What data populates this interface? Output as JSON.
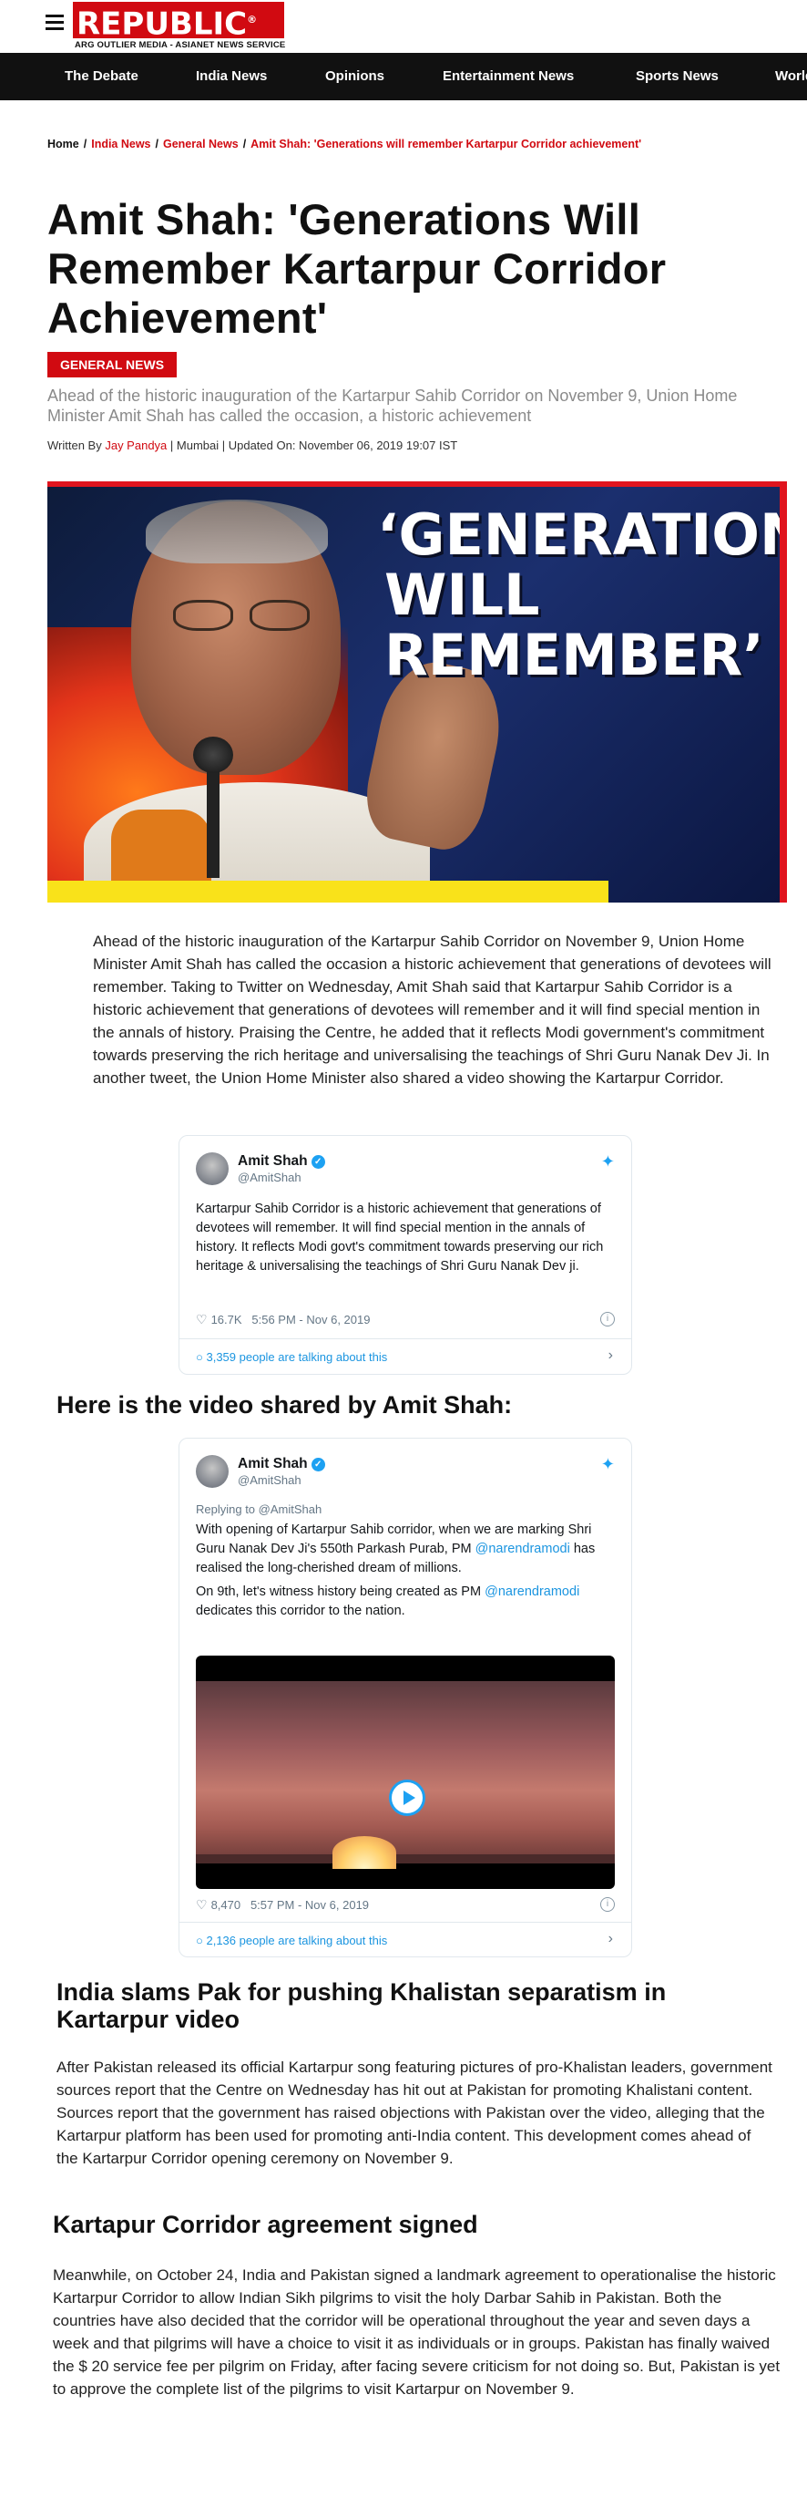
{
  "header": {
    "logo": "REPUBLIC",
    "logo_reg": "®",
    "logo_subtitle": "ARG OUTLIER MEDIA - ASIANET NEWS SERVICE",
    "nav": [
      "The Debate",
      "India News",
      "Opinions",
      "Entertainment News",
      "Sports News",
      "World"
    ]
  },
  "breadcrumb": {
    "home": "Home",
    "items": [
      "India News",
      "General News",
      "Amit Shah: 'Generations will remember Kartarpur Corridor achievement'"
    ],
    "separator": "/"
  },
  "article": {
    "title": "Amit Shah: 'Generations Will Remember Kartarpur Corridor Achievement'",
    "category": "GENERAL NEWS",
    "subtitle": "Ahead of the historic inauguration of the Kartarpur Sahib Corridor on November 9, Union Home Minister Amit Shah has called the occasion, a historic achievement",
    "byline_prefix": "Written By",
    "author": "Jay Pandya",
    "byline_rest": "| Mumbai | Updated On: November 06, 2019 19:07 IST",
    "hero_text": [
      "‘GENERATIONS",
      "WILL",
      "REMEMBER’"
    ],
    "paragraph1": "Ahead of the historic inauguration of the Kartarpur Sahib Corridor on November 9, Union Home Minister Amit Shah has called the occasion a historic achievement that generations of devotees will remember. Taking to Twitter on Wednesday, Amit Shah said that Kartarpur Sahib Corridor is a historic achievement that generations of devotees will remember and it will find special mention in the annals of history. Praising the Centre, he added that it reflects Modi government's commitment towards preserving the rich heritage and universalising the teachings of Shri Guru Nanak Dev Ji. In another tweet, the Union Home Minister also shared a video showing the Kartarpur Corridor.",
    "heading_video": "Here is the video shared by Amit Shah:",
    "heading_slams": "India slams Pak for pushing Khalistan separatism in Kartarpur video",
    "paragraph2": "After Pakistan released its official Kartarpur song featuring pictures of pro-Khalistan leaders, government sources report that the Centre on Wednesday has hit out at Pakistan for promoting Khalistani content. Sources report that the government has raised objections with Pakistan over the video, alleging that the Kartarpur platform has been used for promoting anti-India content. This development comes ahead of the Kartarpur Corridor opening ceremony on November 9.",
    "heading_agreement": "Kartapur Corridor agreement signed",
    "paragraph3": "Meanwhile, on October 24, India and Pakistan signed a landmark agreement to operationalise the historic Kartarpur Corridor to allow Indian Sikh pilgrims to visit the holy Darbar Sahib in Pakistan. Both the countries have also decided that the corridor will be operational throughout the year and seven days a week and that pilgrims will have a choice to visit it as individuals or in groups. Pakistan has finally waived the $ 20 service fee per pilgrim on Friday, after facing severe criticism for not doing so. But, Pakistan is yet to approve the complete list of the pilgrims to visit Kartarpur on November 9."
  },
  "tweet1": {
    "name": "Amit Shah",
    "verified": "✓",
    "handle": "@AmitShah",
    "text": "Kartarpur Sahib Corridor is a historic achievement that generations of devotees will remember. It will find special mention in the annals of history. It reflects Modi govt's commitment towards preserving our rich heritage & universalising the teachings of Shri Guru Nanak Dev ji.",
    "likes": "16.7K",
    "time": "5:56 PM - Nov 6, 2019",
    "talking": "3,359 people are talking about this"
  },
  "tweet2": {
    "name": "Amit Shah",
    "verified": "✓",
    "handle": "@AmitShah",
    "replying": "Replying to @AmitShah",
    "text_a": "With opening of Kartarpur Sahib corridor, when we are marking Shri Guru Nanak Dev Ji's 550th Parkash Purab, PM",
    "mention1": "@narendramodi",
    "text_b": "has realised the long-cherished dream of millions.",
    "text_c": "On 9th, let's witness history being created as PM",
    "mention2": "@narendramodi",
    "text_d": "dedicates this corridor to the nation.",
    "likes": "8,470",
    "time": "5:57 PM - Nov 6, 2019",
    "talking": "2,136 people are talking about this"
  },
  "icons": {
    "heart": "♡",
    "info": "i",
    "chevron": "›",
    "bird": "✦",
    "talk": "○"
  },
  "colors": {
    "brand_red": "#d10a11",
    "nav_bg": "#111111",
    "twitter_blue": "#1da1f2",
    "hero_yellow": "#f9e21a"
  }
}
